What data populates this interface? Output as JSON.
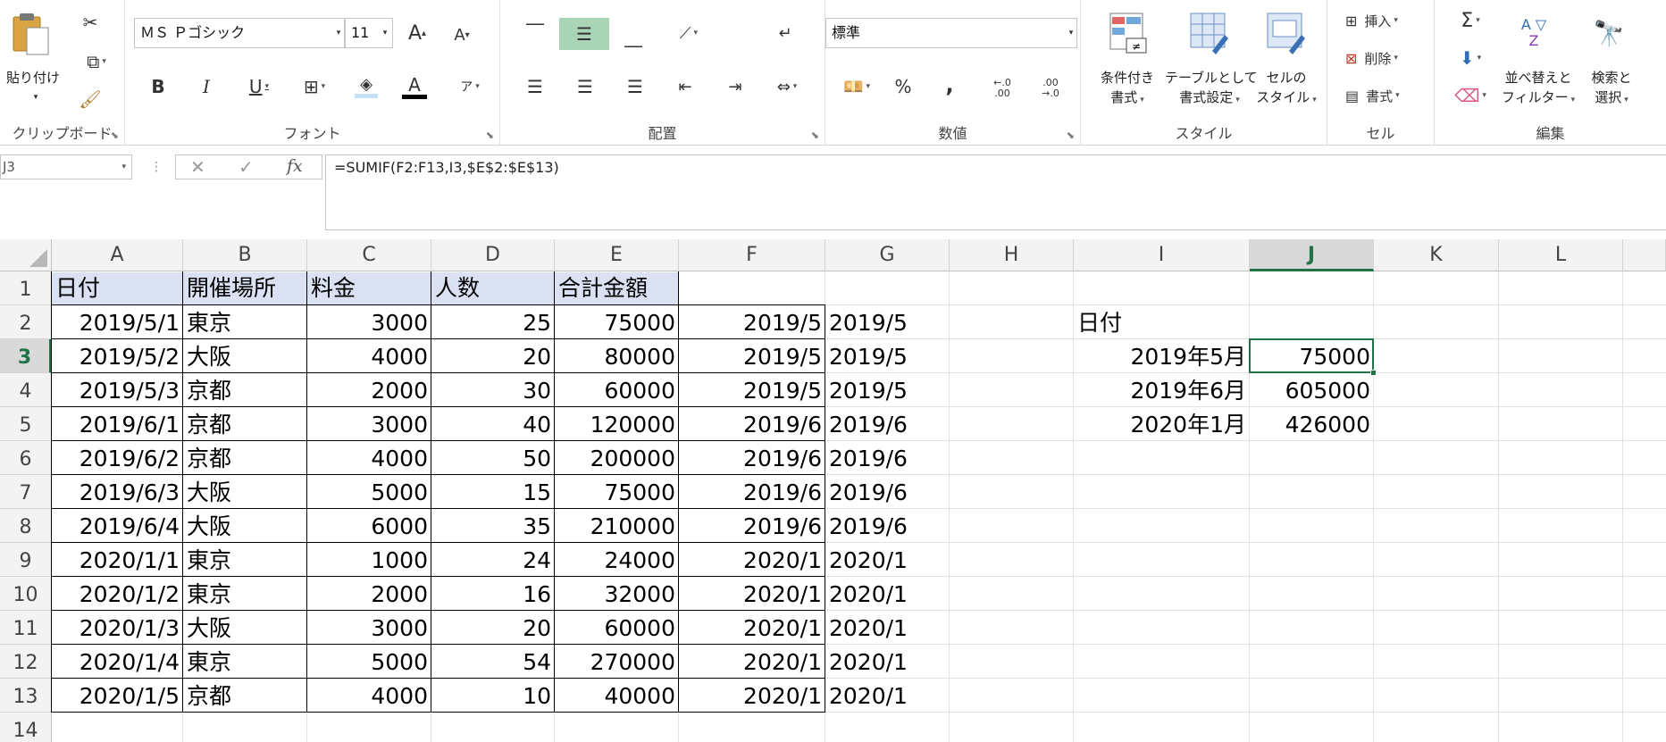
{
  "ribbon": {
    "clipboard": {
      "paste": "貼り付け",
      "label": "クリップボード"
    },
    "font": {
      "name": "ＭＳ Ｐゴシック",
      "size": "11",
      "label": "フォント"
    },
    "alignment": {
      "label": "配置"
    },
    "number": {
      "format": "標準",
      "label": "数値",
      "percent": "%",
      "comma": ",",
      "inc_decimal": "←.0\n.00",
      "dec_decimal": ".00\n→.0"
    },
    "styles": {
      "conditional_l1": "条件付き",
      "conditional_l2": "書式",
      "table_l1": "テーブルとして",
      "table_l2": "書式設定",
      "cell_l1": "セルの",
      "cell_l2": "スタイル",
      "label": "スタイル"
    },
    "cells": {
      "insert": "挿入",
      "delete": "削除",
      "format": "書式",
      "label": "セル"
    },
    "editing": {
      "sort_l1": "並べ替えと",
      "sort_l2": "フィルター",
      "find_l1": "検索と",
      "find_l2": "選択",
      "label": "編集"
    }
  },
  "formula_bar": {
    "name_box": "J3",
    "formula": "=SUMIF(F2:F13,I3,$E$2:$E$13)"
  },
  "sheet": {
    "columns": [
      "A",
      "B",
      "C",
      "D",
      "E",
      "F",
      "G",
      "H",
      "I",
      "J",
      "K",
      "L"
    ],
    "rows": [
      "1",
      "2",
      "3",
      "4",
      "5",
      "6",
      "7",
      "8",
      "9",
      "10",
      "11",
      "12",
      "13",
      "14"
    ],
    "headers": [
      "日付",
      "開催場所",
      "料金",
      "人数",
      "合計金額"
    ],
    "data": [
      [
        "2019/5/1",
        "東京",
        "3000",
        "25",
        "75000",
        "2019/5",
        "2019/5"
      ],
      [
        "2019/5/2",
        "大阪",
        "4000",
        "20",
        "80000",
        "2019/5",
        "2019/5"
      ],
      [
        "2019/5/3",
        "京都",
        "2000",
        "30",
        "60000",
        "2019/5",
        "2019/5"
      ],
      [
        "2019/6/1",
        "京都",
        "3000",
        "40",
        "120000",
        "2019/6",
        "2019/6"
      ],
      [
        "2019/6/2",
        "京都",
        "4000",
        "50",
        "200000",
        "2019/6",
        "2019/6"
      ],
      [
        "2019/6/3",
        "大阪",
        "5000",
        "15",
        "75000",
        "2019/6",
        "2019/6"
      ],
      [
        "2019/6/4",
        "大阪",
        "6000",
        "35",
        "210000",
        "2019/6",
        "2019/6"
      ],
      [
        "2020/1/1",
        "東京",
        "1000",
        "24",
        "24000",
        "2020/1",
        "2020/1"
      ],
      [
        "2020/1/2",
        "東京",
        "2000",
        "16",
        "32000",
        "2020/1",
        "2020/1"
      ],
      [
        "2020/1/3",
        "大阪",
        "3000",
        "20",
        "60000",
        "2020/1",
        "2020/1"
      ],
      [
        "2020/1/4",
        "東京",
        "5000",
        "54",
        "270000",
        "2020/1",
        "2020/1"
      ],
      [
        "2020/1/5",
        "京都",
        "4000",
        "10",
        "40000",
        "2020/1",
        "2020/1"
      ]
    ],
    "summary": {
      "header": "日付",
      "rows": [
        [
          "2019年5月",
          "75000"
        ],
        [
          "2019年6月",
          "605000"
        ],
        [
          "2020年1月",
          "426000"
        ]
      ]
    },
    "selected_cell": "J3",
    "accent_color": "#217346",
    "header_fill": "#d9e1f2"
  }
}
